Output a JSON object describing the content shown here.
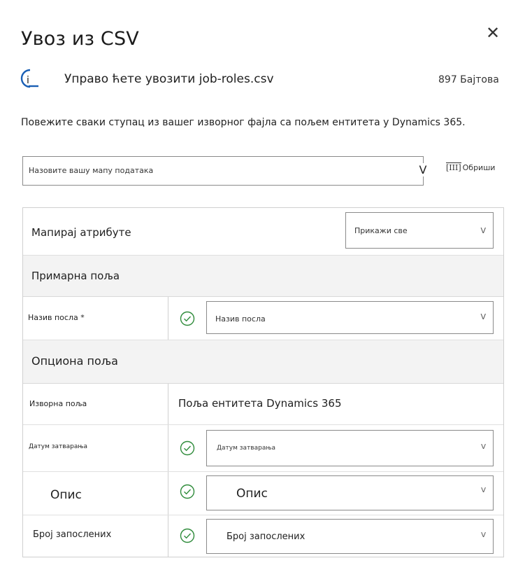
{
  "dialog": {
    "title": "Увоз из CSV",
    "close_glyph": "✕",
    "info_icon_letter": "i",
    "info_text": "Управо ћете увозити job-roles.csv",
    "file_size": "897 Бајтова",
    "instruction": "Повежите сваки ступац из вашег изворног фајла са пољем ентитета у Dynamics 365."
  },
  "map_name": {
    "placeholder": "Назовите вашу мапу података",
    "chevron": "V",
    "delete_icon": "[III]",
    "delete_label": "Обриши"
  },
  "panel": {
    "header_label": "Мапирај атрибуте",
    "filter_value": "Прикажи све",
    "filter_chevron": "V",
    "primary_section": "Примарна поља",
    "optional_section": "Опциона поља",
    "col_source": "Изворна поља",
    "col_target": "Поља ентитета Dynamics 365",
    "primary_rows": [
      {
        "source": "Назив посла *",
        "target": "Назив посла",
        "chevron": "V"
      }
    ],
    "optional_rows": [
      {
        "source": "Датум затварања",
        "target": "Датум затварања",
        "chevron": "V"
      },
      {
        "source": "Опис",
        "target": "Опис",
        "chevron": "V"
      },
      {
        "source": "Број запослених",
        "target": "Број запослених",
        "chevron": "V"
      }
    ]
  },
  "colors": {
    "accent": "#1a5fb4",
    "check": "#2e8b3a",
    "section_bg": "#f3f3f3"
  },
  "icons": {
    "info": "info-icon",
    "close": "close-icon",
    "check": "check-circle-icon",
    "delete": "trash-icon"
  }
}
